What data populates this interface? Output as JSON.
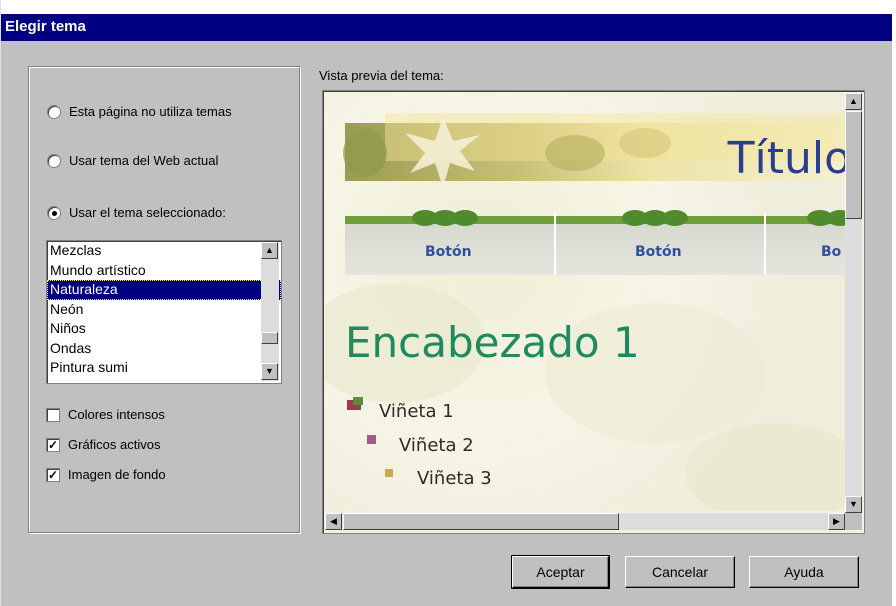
{
  "dialog": {
    "title": "Elegir tema"
  },
  "options": {
    "radio_none": "Esta página no utiliza temas",
    "radio_current": "Usar tema del Web actual",
    "radio_selected": "Usar el tema seleccionado:"
  },
  "themes": [
    "Mezclas",
    "Mundo artístico",
    "Naturaleza",
    "Neón",
    "Niños",
    "Ondas",
    "Pintura sumi"
  ],
  "selected_theme": "Naturaleza",
  "checkboxes": {
    "vivid": {
      "label": "Colores intensos",
      "checked": false
    },
    "active": {
      "label": "Gráficos activos",
      "checked": true
    },
    "background": {
      "label": "Imagen de fondo",
      "checked": true
    }
  },
  "preview": {
    "label": "Vista previa del tema:",
    "title": "Título",
    "buttons": [
      "Botón",
      "Botón",
      "Bo"
    ],
    "heading": "Encabezado 1",
    "bullets": [
      "Viñeta 1",
      "Viñeta 2",
      "Viñeta 3"
    ]
  },
  "footer": {
    "ok": "Aceptar",
    "cancel": "Cancelar",
    "help": "Ayuda"
  },
  "colors": {
    "titlebar": "#000080",
    "heading": "#1e8a5e",
    "banner_title": "#2a3d8f",
    "button_text": "#2f4fa0"
  }
}
